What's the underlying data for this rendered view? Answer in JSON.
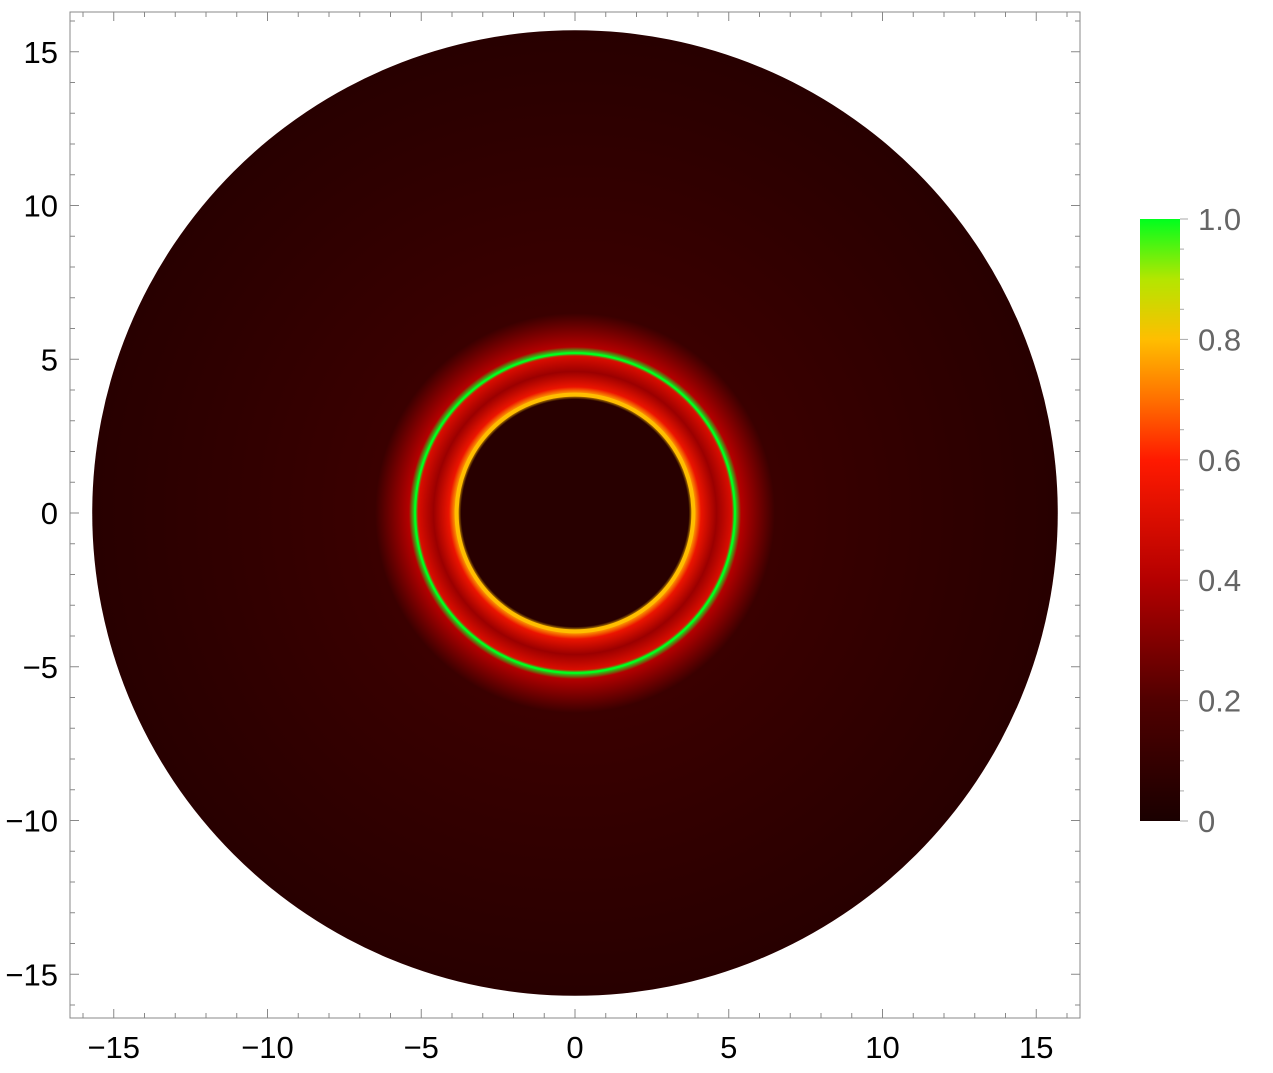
{
  "chart_data": {
    "type": "heatmap",
    "title": "",
    "xlabel": "",
    "ylabel": "",
    "xlim": [
      -16.3,
      16.3
    ],
    "ylim": [
      -16.3,
      16.3
    ],
    "x_ticks": [
      -15,
      -10,
      -5,
      0,
      5,
      10,
      15
    ],
    "y_ticks": [
      -15,
      -10,
      -5,
      0,
      5,
      10,
      15
    ],
    "x_tick_labels": [
      "−15",
      "−10",
      "−5",
      "0",
      "5",
      "10",
      "15"
    ],
    "y_tick_labels": [
      "−15",
      "−10",
      "−5",
      "0",
      "5",
      "10",
      "15"
    ],
    "grid": false,
    "disk_outer_radius": 15.7,
    "disk_base_intensity": 0.05,
    "shadow_radius": 3.8,
    "inner_ring_radius": 3.85,
    "inner_ring_peak_intensity": 0.8,
    "outer_ring_radius": 5.2,
    "outer_ring_peak_intensity": 1.0,
    "radial_profile": [
      {
        "r": 0.0,
        "intensity": 0.05
      },
      {
        "r": 3.7,
        "intensity": 0.05
      },
      {
        "r": 3.85,
        "intensity": 0.8
      },
      {
        "r": 4.1,
        "intensity": 0.55
      },
      {
        "r": 4.6,
        "intensity": 0.35
      },
      {
        "r": 5.1,
        "intensity": 0.5
      },
      {
        "r": 5.2,
        "intensity": 1.0
      },
      {
        "r": 5.4,
        "intensity": 0.4
      },
      {
        "r": 6.5,
        "intensity": 0.12
      },
      {
        "r": 15.7,
        "intensity": 0.05
      }
    ],
    "colorbar": {
      "min": 0,
      "max": 1.0,
      "tick_labels": [
        "0",
        "0.2",
        "0.4",
        "0.6",
        "0.8",
        "1.0"
      ],
      "tick_values": [
        0,
        0.2,
        0.4,
        0.6,
        0.8,
        1.0
      ],
      "colors": [
        {
          "stop": 0.0,
          "color": "#1a0000"
        },
        {
          "stop": 0.2,
          "color": "#500000"
        },
        {
          "stop": 0.4,
          "color": "#b40000"
        },
        {
          "stop": 0.6,
          "color": "#ff1a00"
        },
        {
          "stop": 0.7,
          "color": "#ff7000"
        },
        {
          "stop": 0.8,
          "color": "#ffbe00"
        },
        {
          "stop": 0.9,
          "color": "#b4e600"
        },
        {
          "stop": 1.0,
          "color": "#00ff1e"
        }
      ]
    },
    "colors": {
      "background_disk": "#250000",
      "shadow": "#200000",
      "frame": "#888888"
    }
  }
}
